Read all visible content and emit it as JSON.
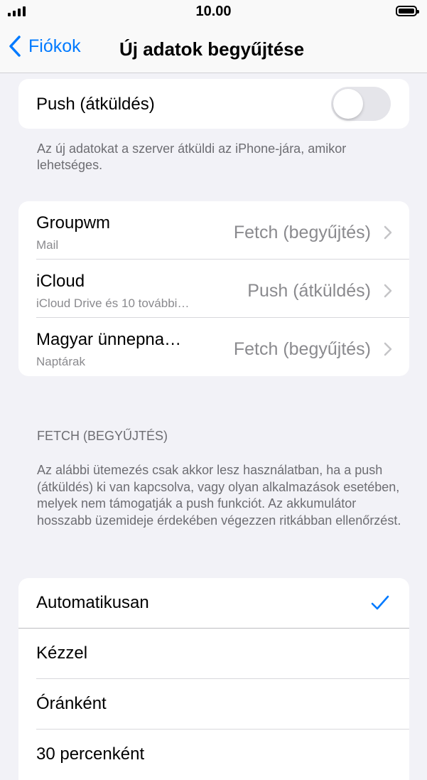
{
  "status_bar": {
    "time": "10.00"
  },
  "nav": {
    "back_label": "Fiókok",
    "title": "Új adatok begyűjtése"
  },
  "push": {
    "label": "Push (átküldés)",
    "enabled": false,
    "footer": "Az új adatokat a szerver átküldi az iPhone-jára, amikor lehetséges."
  },
  "accounts": [
    {
      "name": "Groupwm",
      "detail": "Mail",
      "value": "Fetch (begyűjtés)"
    },
    {
      "name": "iCloud",
      "detail": "iCloud Drive és 10 további…",
      "value": "Push (átküldés)"
    },
    {
      "name": "Magyar ünnepna…",
      "detail": "Naptárak",
      "value": "Fetch (begyűjtés)"
    }
  ],
  "fetch": {
    "header": "FETCH (BEGYŰJTÉS)",
    "description": "Az alábbi ütemezés csak akkor lesz használatban, ha a push (átküldés) ki van kapcsolva, vagy olyan alkalmazások esetében, melyek nem támogatják a push funkciót. Az akkumulátor hosszabb üzemideje érdekében végezzen ritkábban ellenőrzést.",
    "options": [
      {
        "label": "Automatikusan",
        "selected": true
      },
      {
        "label": "Kézzel",
        "selected": false
      },
      {
        "label": "Óránként",
        "selected": false
      },
      {
        "label": "30 percenként",
        "selected": false
      }
    ]
  },
  "colors": {
    "accent": "#007aff",
    "background": "#f2f2f7",
    "secondary_text": "#8a8a8e"
  }
}
